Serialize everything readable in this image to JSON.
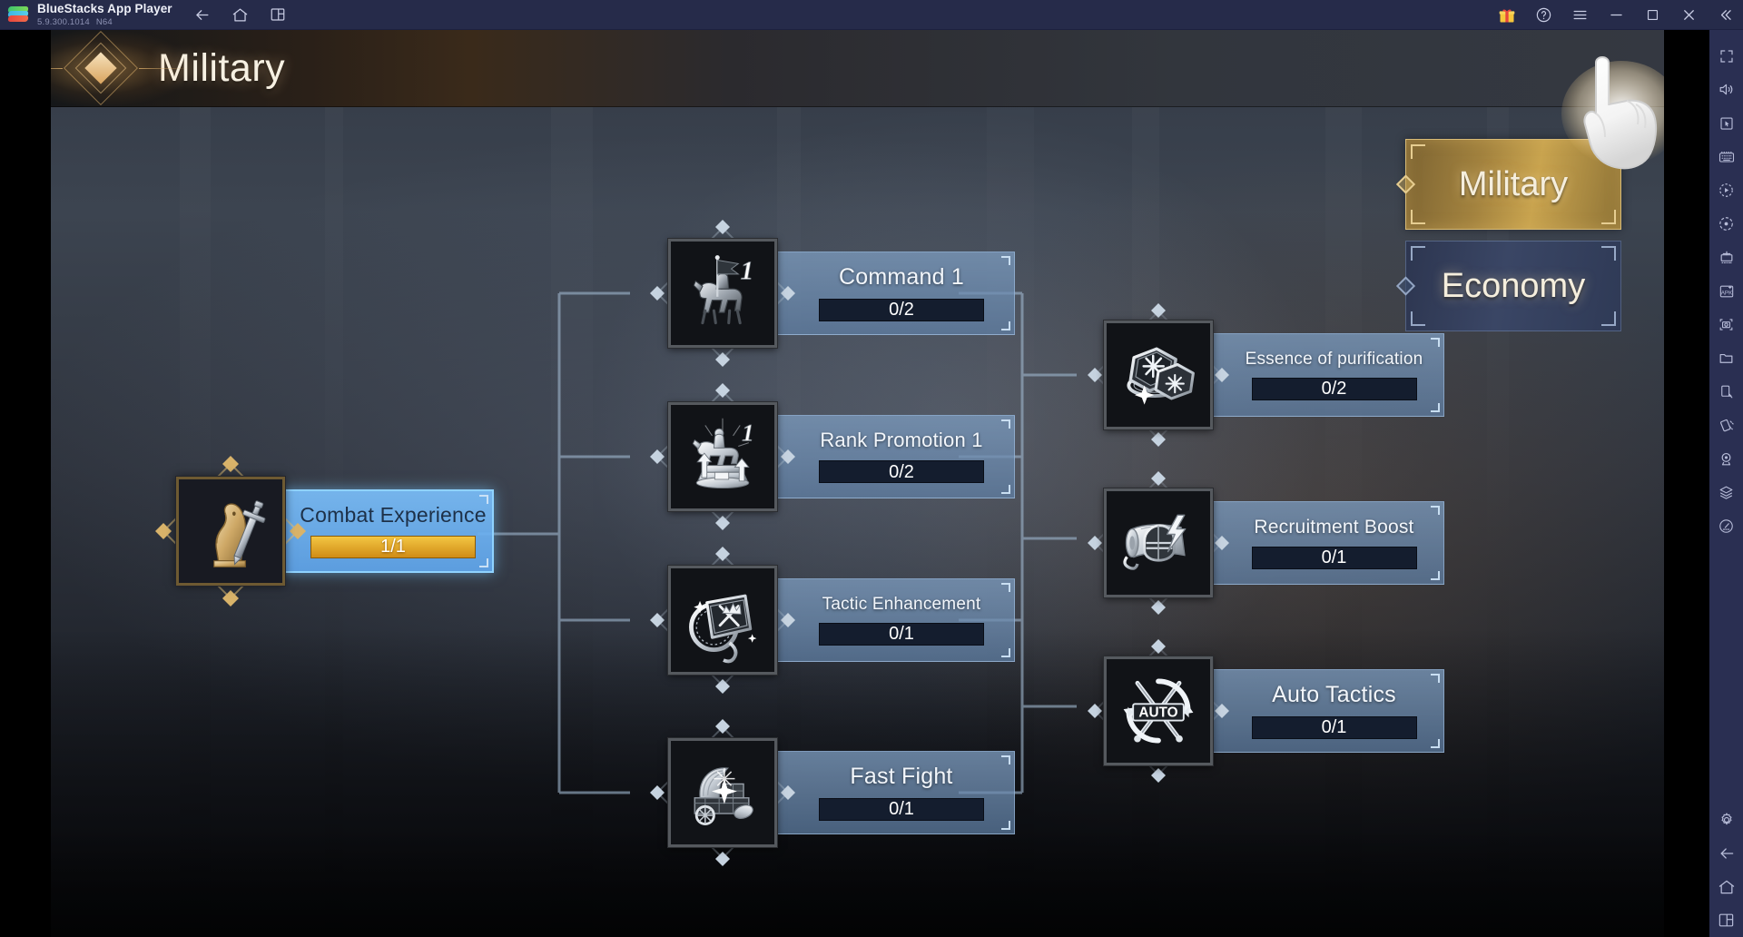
{
  "titlebar": {
    "app_name": "BlueStacks App Player",
    "version": "5.9.300.1014",
    "arch": "N64",
    "nav_icons": [
      "back-icon",
      "home-icon",
      "multi-instance-icon"
    ],
    "right_icons": [
      "gift-icon",
      "help-icon",
      "menu-icon",
      "minimize-icon",
      "maximize-icon",
      "close-icon",
      "collapse-icon"
    ],
    "bg_color": "#262b4a"
  },
  "sidebar": {
    "bg_color": "#2a2f52",
    "items": [
      {
        "name": "fullscreen-icon"
      },
      {
        "name": "volume-icon"
      },
      {
        "name": "pointer-icon"
      },
      {
        "name": "keyboard-controls-icon"
      },
      {
        "name": "macro-record-icon"
      },
      {
        "name": "rotate-icon"
      },
      {
        "name": "multi-instance-manager-icon"
      },
      {
        "name": "install-apk-icon"
      },
      {
        "name": "screenshot-icon"
      },
      {
        "name": "media-folder-icon"
      },
      {
        "name": "shake-icon"
      },
      {
        "name": "tilt-icon"
      },
      {
        "name": "location-icon"
      },
      {
        "name": "layers-icon"
      },
      {
        "name": "performance-icon"
      }
    ],
    "bottom_items": [
      {
        "name": "settings-icon"
      },
      {
        "name": "back-icon"
      },
      {
        "name": "home-icon"
      },
      {
        "name": "recents-icon"
      }
    ]
  },
  "game": {
    "header": {
      "title": "Military",
      "accent_color": "#d9a45e"
    },
    "tabs": [
      {
        "label": "Military",
        "active": true
      },
      {
        "label": "Economy",
        "active": false
      }
    ],
    "cursor": "pointing-hand-cursor",
    "nodes": [
      {
        "id": "combat-experience",
        "name": "Combat Experience",
        "progress": "1/1",
        "state": "owned",
        "icon": "knight-chess-sword-icon",
        "level_badge": ""
      },
      {
        "id": "command-1",
        "name": "Command 1",
        "progress": "0/2",
        "state": "locked",
        "icon": "mounted-knight-banner-icon",
        "level_badge": "1"
      },
      {
        "id": "rank-promotion-1",
        "name": "Rank Promotion 1",
        "progress": "0/2",
        "state": "locked",
        "icon": "equestrian-statue-icon",
        "level_badge": "1"
      },
      {
        "id": "tactic-enhancement",
        "name": "Tactic Enhancement",
        "progress": "0/1",
        "state": "locked",
        "icon": "tactics-book-compass-icon",
        "level_badge": ""
      },
      {
        "id": "fast-fight",
        "name": "Fast Fight",
        "progress": "0/1",
        "state": "locked",
        "icon": "supply-wagon-icon",
        "level_badge": ""
      },
      {
        "id": "essence-of-purification",
        "name": "Essence of purification",
        "progress": "0/2",
        "state": "locked",
        "icon": "purification-gems-icon",
        "level_badge": ""
      },
      {
        "id": "recruitment-boost",
        "name": "Recruitment Boost",
        "progress": "0/1",
        "state": "locked",
        "icon": "helmet-scroll-lightning-icon",
        "level_badge": ""
      },
      {
        "id": "auto-tactics",
        "name": "Auto Tactics",
        "progress": "0/1",
        "state": "locked",
        "icon": "auto-crossed-swords-icon",
        "level_badge": ""
      }
    ]
  }
}
